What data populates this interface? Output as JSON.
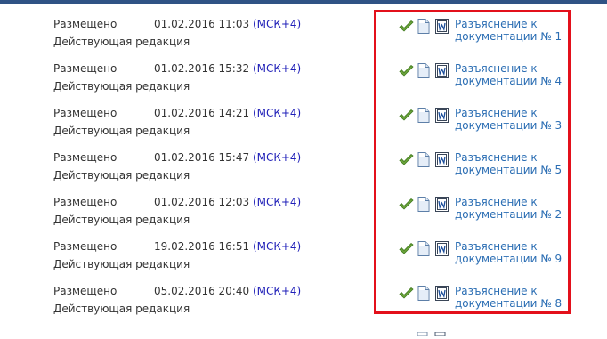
{
  "colors": {
    "header": "#2f5385",
    "link": "#2a6db3",
    "timezone": "#1f1fb8",
    "highlight": "#e3101b"
  },
  "icons": {
    "approved": "check-icon",
    "document": "document-icon",
    "word": "word-doc-icon"
  },
  "rows": [
    {
      "status": "Размещено",
      "datetime": "01.02.2016 11:03",
      "timezone": "(МСК+4)",
      "edition": "Действующая редакция",
      "link_line1": "Разъяснение к",
      "link_line2": "документации № 1"
    },
    {
      "status": "Размещено",
      "datetime": "01.02.2016 15:32",
      "timezone": "(МСК+4)",
      "edition": "Действующая редакция",
      "link_line1": "Разъяснение к",
      "link_line2": "документации № 4"
    },
    {
      "status": "Размещено",
      "datetime": "01.02.2016 14:21",
      "timezone": "(МСК+4)",
      "edition": "Действующая редакция",
      "link_line1": "Разъяснение к",
      "link_line2": "документации № 3"
    },
    {
      "status": "Размещено",
      "datetime": "01.02.2016 15:47",
      "timezone": "(МСК+4)",
      "edition": "Действующая редакция",
      "link_line1": "Разъяснение к",
      "link_line2": "документации № 5"
    },
    {
      "status": "Размещено",
      "datetime": "01.02.2016 12:03",
      "timezone": "(МСК+4)",
      "edition": "Действующая редакция",
      "link_line1": "Разъяснение к",
      "link_line2": "документации № 2"
    },
    {
      "status": "Размещено",
      "datetime": "19.02.2016 16:51",
      "timezone": "(МСК+4)",
      "edition": "Действующая редакция",
      "link_line1": "Разъяснение к",
      "link_line2": "документации № 9"
    },
    {
      "status": "Размещено",
      "datetime": "05.02.2016 20:40",
      "timezone": "(МСК+4)",
      "edition": "Действующая редакция",
      "link_line1": "Разъяснение к",
      "link_line2": "документации № 8"
    }
  ]
}
